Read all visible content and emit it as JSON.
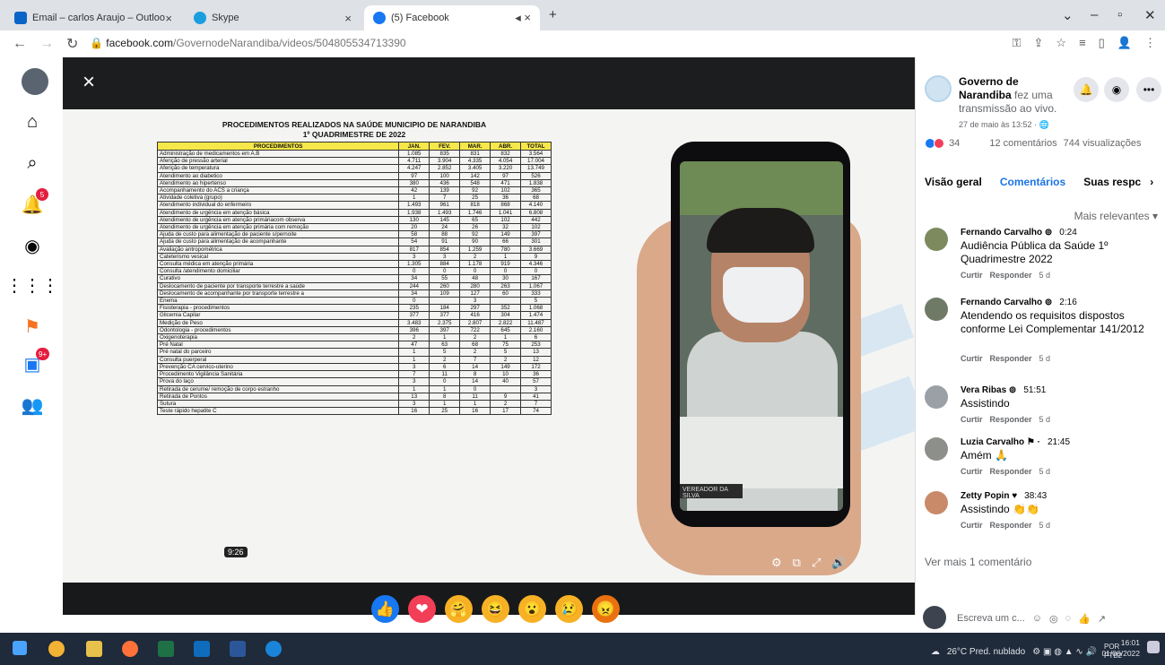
{
  "browser": {
    "tabs": [
      {
        "label": "Email – carlos Araujo – Outlook",
        "color": "#0a64c8"
      },
      {
        "label": "Skype",
        "color": "#1a9ee0"
      },
      {
        "label": "(5) Facebook",
        "color": "#1877f2"
      }
    ],
    "address": {
      "host": "facebook.com",
      "path": "/GovernodeNarandiba/videos/504805534713390"
    }
  },
  "sidebar": {
    "items": [
      "home-icon",
      "search-icon",
      "notifications-icon",
      "messenger-icon",
      "menu-grid-icon",
      "pages-flag-icon",
      "watch-icon",
      "groups-icon"
    ],
    "badges": {
      "notifications": "5",
      "watch": "9+"
    }
  },
  "video": {
    "timestamp": "9:26",
    "document": {
      "title": "PROCEDIMENTOS REALIZADOS NA SAÚDE  MUNICIPIO DE NARANDIBA",
      "subtitle": "1º QUADRIMESTRE DE 2022",
      "columns": [
        "PROCEDIMENTOS",
        "JAN.",
        "FEV.",
        "MAR.",
        "ABR.",
        "TOTAL"
      ],
      "rows": [
        [
          "Administração de medicamentos em A.B",
          "1.085",
          "835",
          "831",
          "832",
          "3.564"
        ],
        [
          "Aferição de pressão arterial",
          "4.711",
          "3.904",
          "4.335",
          "4.054",
          "17.004"
        ],
        [
          "Aferição de temperatura",
          "4.247",
          "2.852",
          "3.405",
          "3.220",
          "13.749"
        ],
        [
          "Atendimento ao diabetico",
          "97",
          "100",
          "142",
          "97",
          "526"
        ],
        [
          "Atendimento ao hipertenso",
          "380",
          "436",
          "548",
          "471",
          "1.838"
        ],
        [
          "Acompanhamento do ACS a criança",
          "42",
          "139",
          "92",
          "102",
          "365"
        ],
        [
          "Atividade coletiva (grupo)",
          "1",
          "7",
          "25",
          "36",
          "68"
        ],
        [
          "Atendimento individual do enfermeiro",
          "1.493",
          "961",
          "818",
          "868",
          "4.140"
        ],
        [
          "Atendimento de urgência em atenção básica",
          "1.938",
          "1.493",
          "1.746",
          "1.041",
          "6.808"
        ],
        [
          "Atendimento de urgência em atenção primáriacom observa",
          "130",
          "145",
          "65",
          "102",
          "442"
        ],
        [
          "Atendimento de urgência em atenção primária com remoção",
          "20",
          "24",
          "26",
          "32",
          "102"
        ],
        [
          "Ajuda de custo para alimentação de paciente s/pernoite",
          "58",
          "88",
          "92",
          "149",
          "397"
        ],
        [
          "Ajuda de custo para alimentação de acompanhante",
          "54",
          "91",
          "90",
          "66",
          "301"
        ],
        [
          "Avaliação antropométrica",
          "817",
          "854",
          "1.259",
          "780",
          "3.669"
        ],
        [
          "Cateterismo vesical",
          "3",
          "3",
          "2",
          "1",
          "9"
        ],
        [
          "Consulta médica em atenção primária",
          "1.305",
          "884",
          "1.178",
          "919",
          "4.346"
        ],
        [
          "Consulta /atendimento domiciliar",
          "0",
          "0",
          "0",
          "0",
          "0"
        ],
        [
          "Curativo",
          "34",
          "55",
          "48",
          "30",
          "167"
        ],
        [
          "Deslocamento de paciente por transporte terrestre a saúde",
          "244",
          "260",
          "280",
          "263",
          "1.067"
        ],
        [
          "Deslocamento de acompanhante por transporte terrestre a",
          "34",
          "109",
          "127",
          "60",
          "333"
        ],
        [
          "Enema",
          "0",
          "",
          "3",
          "",
          "5"
        ],
        [
          "Fisioterapia - procedimentos",
          "235",
          "184",
          "297",
          "352",
          "1.068"
        ],
        [
          "Glicemia Capilar",
          "377",
          "377",
          "416",
          "304",
          "1.474"
        ],
        [
          "Medição de Peso",
          "3.483",
          "2.375",
          "2.807",
          "2.822",
          "11.487"
        ],
        [
          "Odontologia - procedimentos",
          "396",
          "397",
          "722",
          "645",
          "2.160"
        ],
        [
          "Oxigenoterapia",
          "2",
          "1",
          "2",
          "1",
          "6"
        ],
        [
          "Pré Natal",
          "47",
          "63",
          "68",
          "75",
          "253"
        ],
        [
          "Pré natal do parceiro",
          "1",
          "5",
          "2",
          "5",
          "13"
        ],
        [
          "Consulta puerperal",
          "1",
          "2",
          "7",
          "2",
          "12"
        ],
        [
          "Prevenção CA cervico-uterino",
          "3",
          "6",
          "14",
          "149",
          "172"
        ],
        [
          "Procedimento Vigilância Sanitária",
          "7",
          "11",
          "8",
          "10",
          "36"
        ],
        [
          "Prova do laço",
          "3",
          "0",
          "14",
          "40",
          "57"
        ],
        [
          "Retirada de cerume/ remoção de corpo estranho",
          "1",
          "1",
          "0",
          "",
          "3"
        ],
        [
          "Retirada de Pontos",
          "13",
          "8",
          "11",
          "9",
          "41"
        ],
        [
          "Sutura",
          "3",
          "1",
          "1",
          "2",
          "7"
        ],
        [
          "Teste rápido hepatite C",
          "16",
          "25",
          "16",
          "17",
          "74"
        ]
      ]
    },
    "nameplate": "VEREADOR DA SILVA",
    "reactions": [
      {
        "name": "like-reaction-icon",
        "color": "#1877f2",
        "glyph": "👍"
      },
      {
        "name": "love-reaction-icon",
        "color": "#f33e58",
        "glyph": "❤"
      },
      {
        "name": "care-reaction-icon",
        "color": "#f7b125",
        "glyph": "🤗"
      },
      {
        "name": "haha-reaction-icon",
        "color": "#f7b125",
        "glyph": "😆"
      },
      {
        "name": "wow-reaction-icon",
        "color": "#f7b125",
        "glyph": "😮"
      },
      {
        "name": "sad-reaction-icon",
        "color": "#f7b125",
        "glyph": "😢"
      },
      {
        "name": "angry-reaction-icon",
        "color": "#e9710f",
        "glyph": "😠"
      }
    ]
  },
  "post": {
    "page_name": "Governo de Narandiba",
    "action": "fez uma transmissão ao vivo.",
    "time": "27 de maio às 13:52 · ",
    "reactions_count": "34",
    "comments_count": "12 comentários",
    "views": "744 visualizações"
  },
  "tabs": [
    {
      "label": "Visão geral",
      "selected": false
    },
    {
      "label": "Comentários",
      "selected": true
    },
    {
      "label": "Suas respc",
      "selected": false
    }
  ],
  "sort_label": "Mais relevantes ▾",
  "comments": [
    {
      "author": "Fernando Carvalho ⊚",
      "time": "0:24",
      "text": "Audiência Pública da Saúde 1º Quadrimestre 2022",
      "like": "Curtir",
      "reply": "Responder",
      "age": "5 d"
    },
    {
      "author": "Fernando Carvalho ⊚",
      "time": "2:16",
      "text": "Atendendo os requisitos dispostos conforme Lei Complementar 141/2012",
      "like": "Curtir",
      "reply": "Responder",
      "age": "5 d"
    },
    {
      "author": "Vera Ribas ⊚",
      "time": "51:51",
      "text": "Assistindo",
      "like": "Curtir",
      "reply": "Responder",
      "age": "5 d"
    },
    {
      "author": "Luzia Carvalho ⚑ ·",
      "time": "21:45",
      "text": "Amém 🙏",
      "like": "Curtir",
      "reply": "Responder",
      "age": "5 d"
    },
    {
      "author": "Zetty Popin ♥",
      "time": "38:43",
      "text": "Assistindo 👏👏",
      "like": "Curtir",
      "reply": "Responder",
      "age": "5 d"
    }
  ],
  "more_comments": "Ver mais 1 comentário",
  "composer_placeholder": "Escreva um c...",
  "taskbar": {
    "weather": "26°C  Pred. nublado",
    "lang": "POR",
    "lang2": "PTB2",
    "time": "16:01",
    "date": "01/06/2022"
  }
}
